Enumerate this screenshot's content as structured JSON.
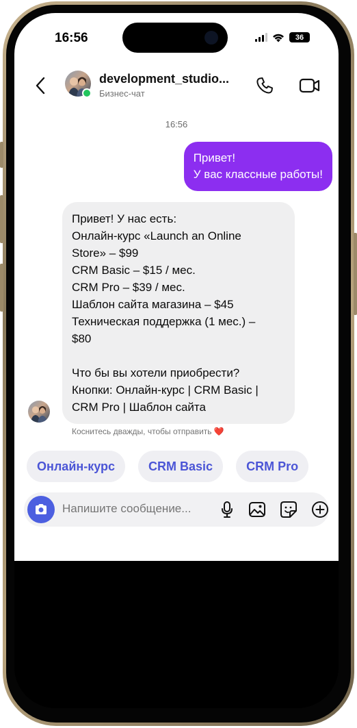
{
  "status_bar": {
    "time": "16:56",
    "battery": "36"
  },
  "header": {
    "contact_name": "development_studio...",
    "contact_subtitle": "Бизнес-чат"
  },
  "chat": {
    "timestamp": "16:56",
    "outgoing": {
      "lines": [
        "Привет!",
        "У вас классные работы!"
      ]
    },
    "incoming": {
      "lines": [
        "Привет! У нас есть:",
        "Онлайн-курс «Launch an Online",
        "Store» – $99",
        "CRM Basic – $15 / мес.",
        "CRM Pro – $39 / мес.",
        "Шаблон сайта магазина – $45",
        "Техническая поддержка (1 мес.) –",
        "$80",
        "",
        "Что бы вы хотели приобрести?",
        "Кнопки: Онлайн-курс | CRM Basic |",
        "CRM Pro | Шаблон сайта"
      ]
    },
    "hint": "Коснитесь дважды, чтобы отправить ❤️"
  },
  "quick_replies": [
    "Онлайн-курс",
    "CRM Basic",
    "CRM Pro"
  ],
  "composer": {
    "placeholder": "Напишите сообщение..."
  },
  "colors": {
    "outgoing_bubble": "#8c2ef0",
    "incoming_bubble": "#efeff0",
    "quick_reply_text": "#4b55d6",
    "camera_button": "#4c5fe0",
    "online_dot": "#22c55e"
  },
  "icons": [
    "back-arrow-icon",
    "phone-icon",
    "video-camera-icon",
    "camera-icon",
    "microphone-icon",
    "image-icon",
    "sticker-icon",
    "plus-icon"
  ]
}
